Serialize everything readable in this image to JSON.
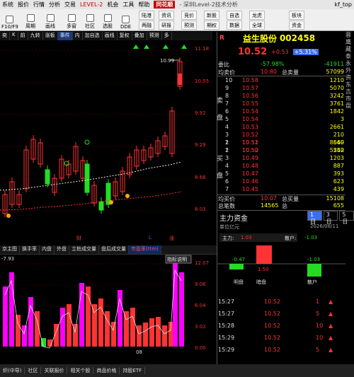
{
  "menu": {
    "items": [
      "系统",
      "报价",
      "行情",
      "分析",
      "交易"
    ],
    "level2": "LEVEL-2",
    "items2": [
      "机会",
      "工具",
      "帮助"
    ],
    "logo": "同花顺",
    "title": "- 深圳Level-2技术分析",
    "right": "kf_top"
  },
  "toolbar": {
    "row1": [
      "F10/F9",
      "周期",
      "画线",
      "多窗",
      "社区",
      "选股",
      "DDE"
    ],
    "pills1": [
      "陆港",
      "资讯",
      "竞价",
      "新股",
      "自选",
      "龙虎",
      "板块"
    ],
    "pills2": [
      "两融",
      "研报",
      "预测",
      "期权",
      "数据",
      "全球",
      "资金"
    ]
  },
  "subtabs": [
    "奕",
    "K",
    "前",
    "九转",
    "涨板",
    "事件",
    "内",
    "加自选",
    "画线",
    "复权",
    "叠加",
    "预测",
    "多"
  ],
  "kchart": {
    "high_label": "10.99",
    "bottom_labels": {
      "a": "财",
      "b": "L",
      "c": "涨"
    }
  },
  "kaxis": {
    "ticks": [
      "11.18",
      "10.55",
      "9.92",
      "9.29",
      "8.66",
      "8.03"
    ]
  },
  "btabs": [
    "京主图",
    "换手率",
    "内盘",
    "外盘",
    "立桩成交量",
    "盘后成交量",
    "市盈率(ttm)"
  ],
  "vchart": {
    "left_val": "-7.93",
    "btn": "指标说明",
    "date": "08"
  },
  "vaxis": {
    "ticks": [
      "12.07",
      "9.06",
      "6.04",
      "3.02",
      "0.00"
    ]
  },
  "stock": {
    "name": "益生股份",
    "code": "002458",
    "mark": "R",
    "price": "10.52",
    "change": "+0.53",
    "pct": "+5.31%"
  },
  "summary": {
    "webi_label": "委比",
    "webi": "-57.98%",
    "wecha": "-41911",
    "avg_label": "均卖价",
    "avg": "10.80",
    "total_label": "总卖量",
    "total": "57099"
  },
  "sell_side": "卖盘",
  "buy_side": "买盘",
  "sells": [
    {
      "i": "10",
      "p": "10.58",
      "q": "1210"
    },
    {
      "i": "9",
      "p": "10.57",
      "q": "5070"
    },
    {
      "i": "8",
      "p": "10.56",
      "q": "3242"
    },
    {
      "i": "7",
      "p": "10.55",
      "q": "3761"
    },
    {
      "i": "6",
      "p": "10.54",
      "q": "1842"
    },
    {
      "i": "5",
      "p": "10.54",
      "q": "3"
    },
    {
      "i": "4",
      "p": "10.53",
      "q": "2661"
    },
    {
      "i": "3",
      "p": "10.52",
      "q": "210"
    },
    {
      "i": "2",
      "p": "10.52",
      "q": "8660"
    },
    {
      "i": "1",
      "p": "10.52",
      "q": "550"
    }
  ],
  "buys": [
    {
      "i": "1",
      "p": "10.51",
      "q": "549"
    },
    {
      "i": "2",
      "p": "10.50",
      "q": "5242"
    },
    {
      "i": "3",
      "p": "10.49",
      "q": "1203"
    },
    {
      "i": "4",
      "p": "10.48",
      "q": "887"
    },
    {
      "i": "5",
      "p": "10.47",
      "q": "393"
    },
    {
      "i": "6",
      "p": "10.46",
      "q": "623"
    },
    {
      "i": "7",
      "p": "10.45",
      "q": "439"
    }
  ],
  "buy_summary": {
    "avg_label": "均买价",
    "avg": "10.07",
    "total_label": "总买量",
    "total": "15108",
    "bi_label": "总笔数",
    "bi": "14565",
    "bi_label2": "总",
    "bi2": "655"
  },
  "capital": {
    "title": "主力资金",
    "unit": "单位亿元",
    "date": "2026/08/11",
    "tabs": [
      "1日",
      "3日",
      "5日"
    ],
    "main_label": "主力:",
    "main_val": "1.03",
    "retail_label": "散户:",
    "retail_val": "-1.03",
    "bar1": "-0.47",
    "bar2": "1.50",
    "bar3": "-1.03",
    "cats": [
      "明盘",
      "暗盘",
      "散户"
    ]
  },
  "trades": [
    {
      "t": "15:27",
      "p": "10.52",
      "v": "1"
    },
    {
      "t": "15:27",
      "p": "10.52",
      "v": "5"
    },
    {
      "t": "15:28",
      "p": "10.52",
      "v": "10"
    },
    {
      "t": "15:29",
      "p": "10.52",
      "v": "10"
    },
    {
      "t": "15:29",
      "p": "10.52",
      "v": "5"
    }
  ],
  "bottombar": [
    "织(中导)",
    "社区",
    "关联报价",
    "相关个股",
    "商品价格",
    "持股ETF"
  ],
  "rwin": "蓉鹰藏泰永外资东吉市盘"
}
